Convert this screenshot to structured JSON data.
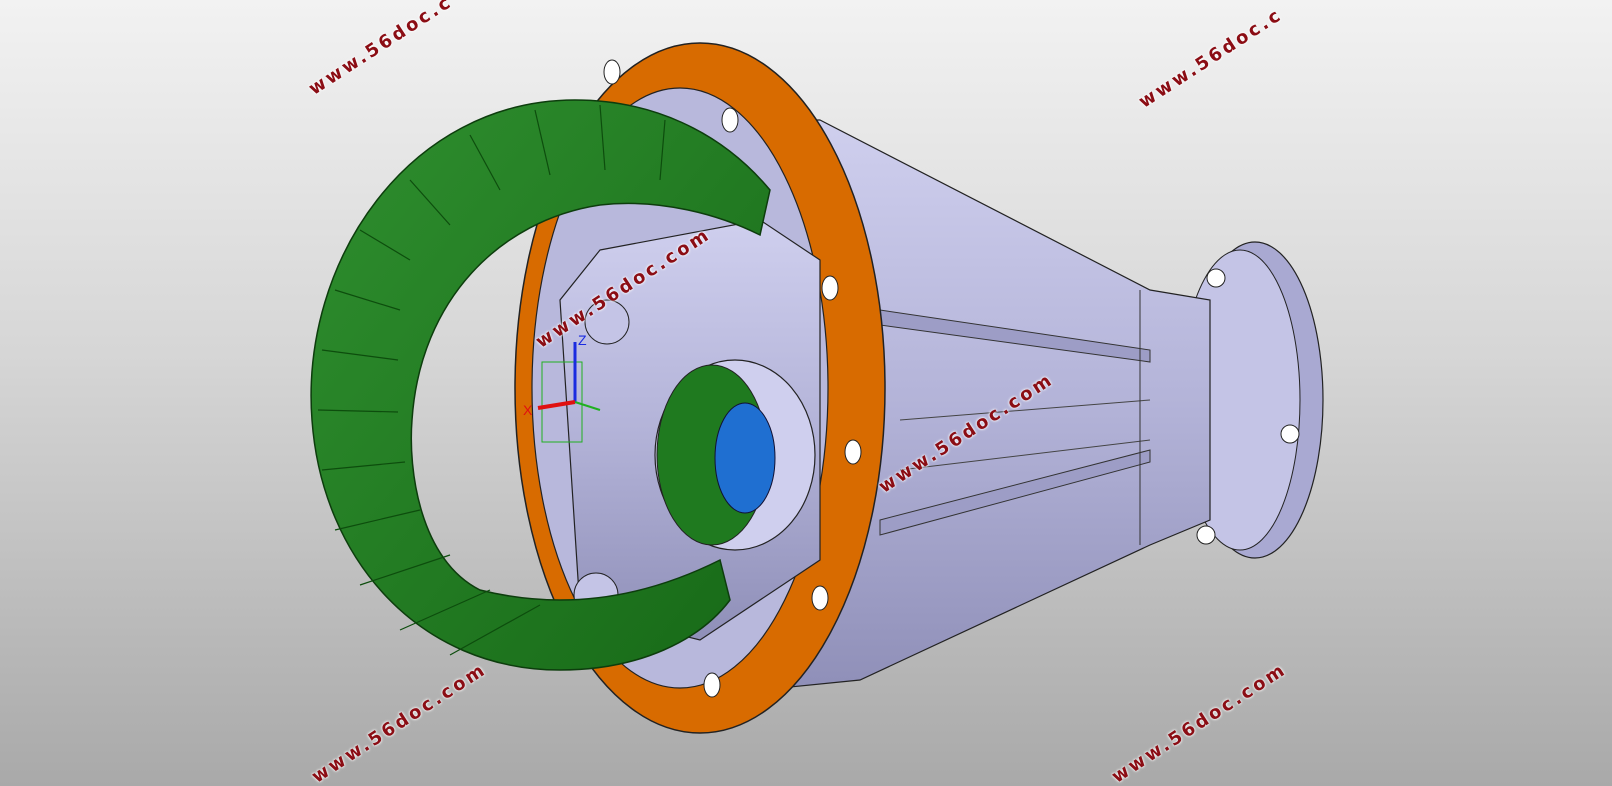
{
  "viewport": {
    "background_top": "#f2f2f2",
    "background_bottom": "#a9a9a9"
  },
  "model": {
    "parts": {
      "housing_color": "#b8b8dc",
      "ring_gear_color": "#1f7a1f",
      "flange_gasket_color": "#d86b00",
      "side_gear_color": "#1f6fd1"
    }
  },
  "triad": {
    "x_label": "X",
    "z_label": "Z",
    "x_color": "#e01010",
    "z_color": "#1a2be0",
    "y_color": "#20b020"
  },
  "watermarks": [
    "www.56doc.c",
    "www.56doc.c",
    "www.56doc.com",
    "www.56doc.com",
    "www.56doc.com",
    "www.56doc.com"
  ]
}
